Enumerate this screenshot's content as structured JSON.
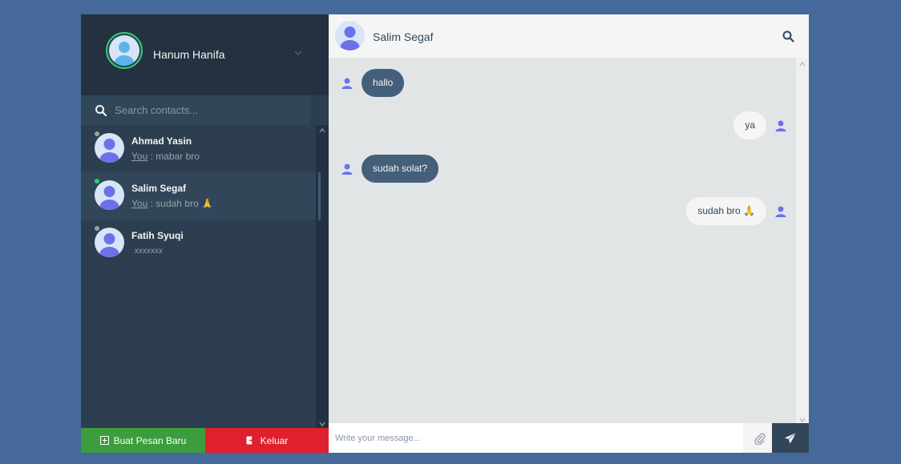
{
  "current_user": {
    "name": "Hanum Hanifa",
    "avatar_icon": "user-avatar-icon",
    "status": "online"
  },
  "search": {
    "placeholder": "Search contacts..."
  },
  "contacts": [
    {
      "name": "Ahmad Yasin",
      "you_label": "You",
      "separator": ":",
      "preview": "mabar bro",
      "status": "offline"
    },
    {
      "name": "Salim Segaf",
      "you_label": "You",
      "separator": ":",
      "preview": "sudah bro 🙏",
      "status": "online",
      "active": true
    },
    {
      "name": "Fatih Syuqi",
      "preview": "xxxxxxx",
      "status": "offline"
    }
  ],
  "buttons": {
    "new_message": "Buat Pesan Baru",
    "logout": "Keluar"
  },
  "chat": {
    "contact_name": "Salim Segaf",
    "messages": [
      {
        "direction": "received",
        "text": "hallo"
      },
      {
        "direction": "sent",
        "text": "ya"
      },
      {
        "direction": "received",
        "text": "sudah solat?"
      },
      {
        "direction": "sent",
        "text": "sudah bro 🙏"
      }
    ]
  },
  "composer": {
    "placeholder": "Write your message..."
  },
  "colors": {
    "background": "#44699a",
    "sidebar": "#2c3e50",
    "received_bubble": "#435f7a",
    "sent_bubble": "#f5f5f5",
    "online": "#2ecc71",
    "new_button": "#3b9d3b",
    "logout_button": "#e0202e"
  }
}
